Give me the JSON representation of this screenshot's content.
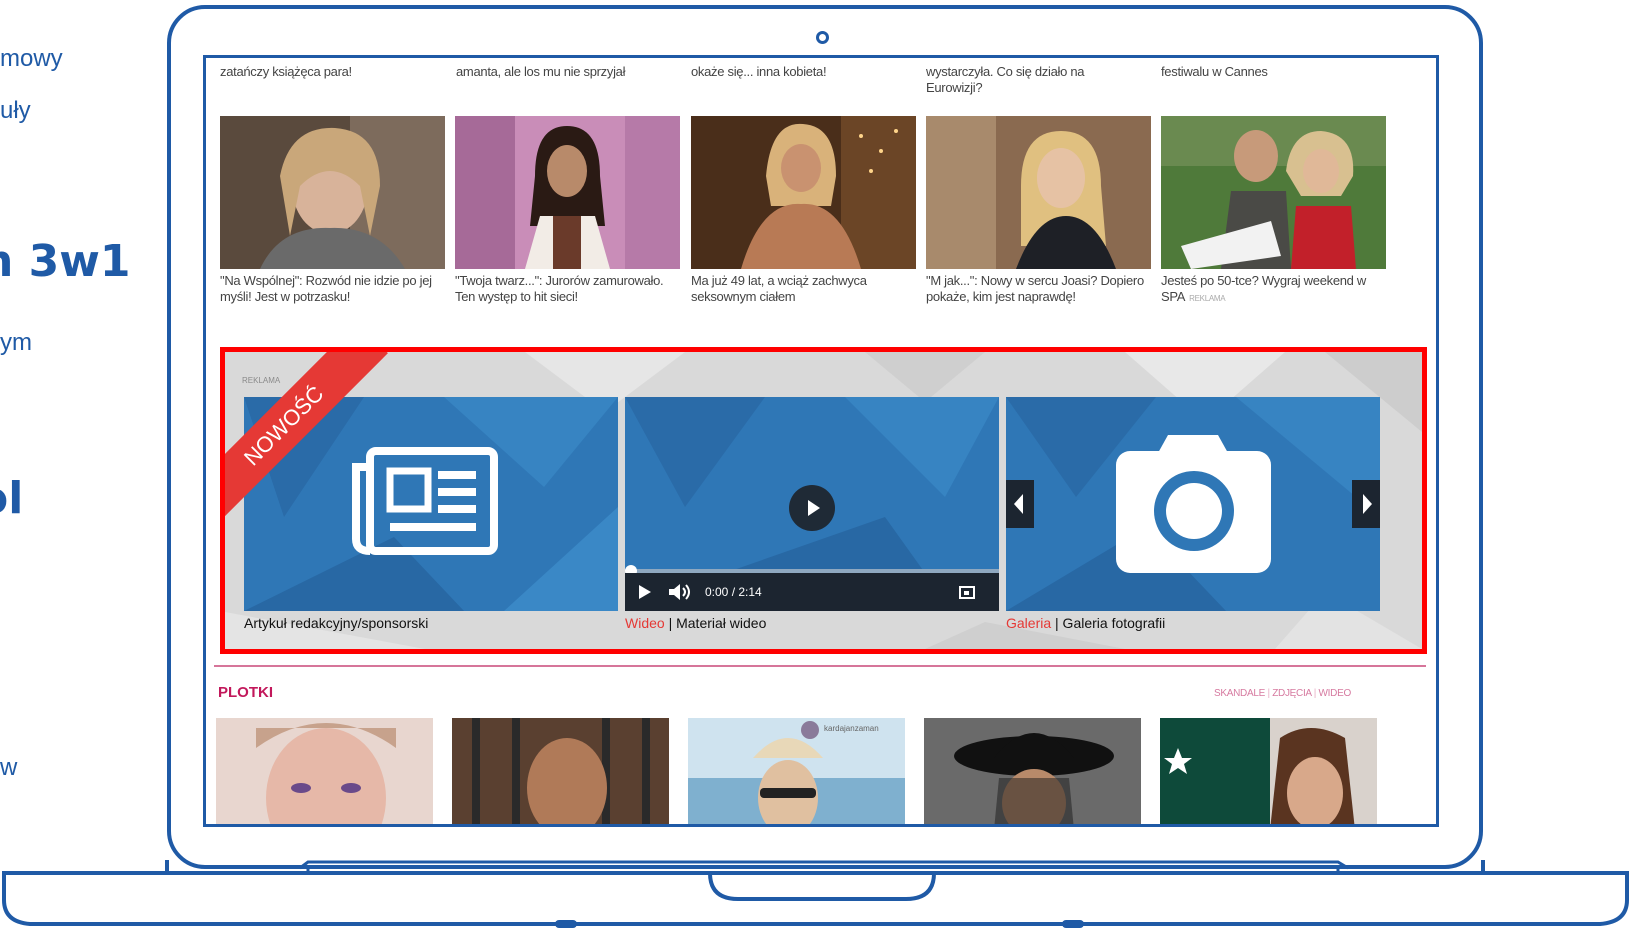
{
  "slide_left": {
    "frag1": "mowy",
    "frag2": "uły",
    "frag3": "n 3w1",
    "frag4": "ym",
    "frag5": "ol",
    "frag6": "w"
  },
  "colors": {
    "frame": "#1f5aa6",
    "highlight_border": "#ff0000",
    "accent_red": "#e53935",
    "plotki_pink": "#c2185b",
    "tile_blue": "#2f77b6"
  },
  "top_captions": [
    "zatańczy książęca para!",
    "amanta, ale los mu nie sprzyjał",
    "okaże się... inna kobieta!",
    "wystarczyła. Co się działo na Eurowizji?",
    "festiwalu w Cannes"
  ],
  "articles": [
    {
      "caption": "\"Na Wspólnej\": Rozwód nie idzie po jej myśli! Jest w potrzasku!",
      "image": "woman-portrait"
    },
    {
      "caption": "\"Twoja twarz...\": Jurorów zamurowało. Ten występ to hit sieci!",
      "image": "stage-performer"
    },
    {
      "caption": "Ma już 49 lat, a wciąż zachwyca seksownym ciałem",
      "image": "blonde-woman-stage"
    },
    {
      "caption": "\"M jak...\": Nowy w sercu Joasi? Dopiero pokaże, kim jest naprawdę!",
      "image": "blonde-woman-scarf"
    },
    {
      "caption": "Jesteś po 50-tce? Wygraj weekend w SPA",
      "badge": "REKLAMA",
      "image": "couple-outdoors"
    }
  ],
  "ad_module": {
    "label": "REKLAMA",
    "ribbon": "NOWOŚĆ",
    "tiles": [
      {
        "icon": "newspaper-icon",
        "label_main": "Artykuł redakcyjny/sponsorski"
      },
      {
        "icon": "play-icon",
        "label_prefix": "Wideo",
        "label_main": " | Materiał wideo",
        "time": "0:00 / 2:14"
      },
      {
        "icon": "camera-icon",
        "label_prefix": "Galeria",
        "label_main": " | Galeria fotografii"
      }
    ]
  },
  "plotki": {
    "title": "PLOTKI",
    "links": [
      "SKANDALE",
      "ZDJĘCIA",
      "WIDEO"
    ],
    "thumb_tag": "kardajanzaman"
  }
}
